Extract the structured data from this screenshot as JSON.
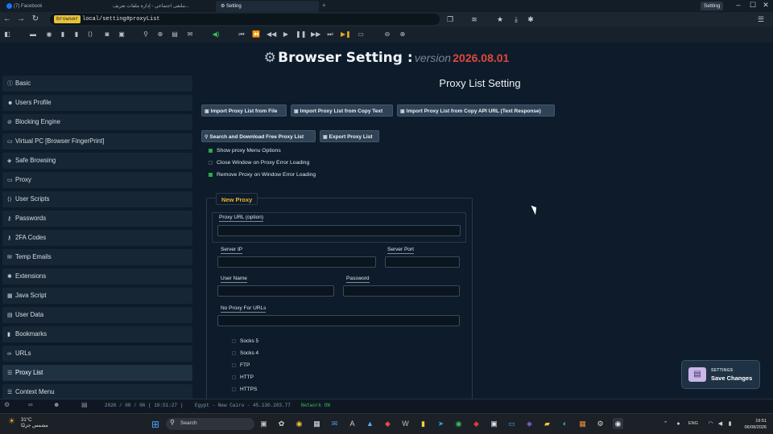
{
  "browser_tabs": [
    {
      "label": "(7) Facebook"
    },
    {
      "label": "ملتقى اجتماعي - إدارة ملفات تعريف..."
    },
    {
      "label": "Setting"
    }
  ],
  "window_title": "Setting",
  "address": {
    "chip": "browser",
    "url": "local/setting#proxyList"
  },
  "page_title": {
    "main": "Browser Setting :",
    "version_label": "version",
    "version": "2026.08.01"
  },
  "sidebar": {
    "items": [
      {
        "label": "Basic",
        "icon": "info-icon"
      },
      {
        "label": "Users Profile",
        "icon": "users-icon"
      },
      {
        "label": "Blocking Engine",
        "icon": "block-icon"
      },
      {
        "label": "Virtual PC [Browser FingerPrint]",
        "icon": "laptop-icon"
      },
      {
        "label": "Safe Browsing",
        "icon": "shield-icon"
      },
      {
        "label": "Proxy",
        "icon": "laptop-icon"
      },
      {
        "label": "User Scripts",
        "icon": "code-icon"
      },
      {
        "label": "Passwords",
        "icon": "key-icon"
      },
      {
        "label": "2FA Codes",
        "icon": "key-icon"
      },
      {
        "label": "Temp Emails",
        "icon": "envelope-icon"
      },
      {
        "label": "Extensions",
        "icon": "puzzle-icon"
      },
      {
        "label": "Java Script",
        "icon": "js-icon"
      },
      {
        "label": "User Data",
        "icon": "database-icon"
      },
      {
        "label": "Bookmarks",
        "icon": "bookmark-icon"
      },
      {
        "label": "URLs",
        "icon": "link-icon"
      },
      {
        "label": "Proxy List",
        "icon": "list-icon",
        "active": true
      },
      {
        "label": "Context Menu",
        "icon": "list-icon"
      }
    ]
  },
  "main": {
    "heading": "Proxy List Setting",
    "buttons": {
      "import_file": "Import Proxy List from File",
      "import_text": "Import Proxy List from Copy Text",
      "import_api": "Import Proxy List from Copy API URL (Text Response)",
      "search_download": "Search and Download Free Proxy List",
      "export": "Export Proxy List"
    },
    "options": [
      {
        "label": "Show proxy Menu Options",
        "checked": true
      },
      {
        "label": "Close Window on Proxy Error Loading",
        "checked": false
      },
      {
        "label": "Remove Proxy on Window Error Loading",
        "checked": true
      }
    ],
    "new_proxy": {
      "legend": "New Proxy",
      "proxy_url_label": "Proxy URL (option)",
      "proxy_url_value": "",
      "server_ip_label": "Server IP",
      "server_ip_value": "",
      "server_port_label": "Server Port",
      "server_port_value": "",
      "username_label": "User Name",
      "username_value": "",
      "password_label": "Password",
      "password_value": "",
      "no_proxy_label": "No Proxy For URLs",
      "no_proxy_value": "",
      "protocols": [
        {
          "label": "Socks 5",
          "checked": false
        },
        {
          "label": "Socks 4",
          "checked": false
        },
        {
          "label": "FTP",
          "checked": false
        },
        {
          "label": "HTTP",
          "checked": false
        },
        {
          "label": "HTTPS",
          "checked": false
        }
      ]
    }
  },
  "toast": {
    "caption": "SETTINGS",
    "action": "Save Changes"
  },
  "statusbar": {
    "datetime": "2026 / 08 / 06 ( 19:51:27 )",
    "location": "Egypt - New Cairo - 45.130.203.77",
    "network": "Network ON"
  },
  "taskbar": {
    "weather_temp": "31°C",
    "weather_desc": "مشمس جزئيًا",
    "search_placeholder": "Search",
    "language": "ENG",
    "time": "19:51",
    "date": "06/08/2026"
  },
  "colors": {
    "background": "#0d1b2a",
    "version_accent": "#e0483b",
    "legend_accent": "#f0b12a",
    "checked": "#2ea84a",
    "url_chip": "#e6c23a"
  }
}
